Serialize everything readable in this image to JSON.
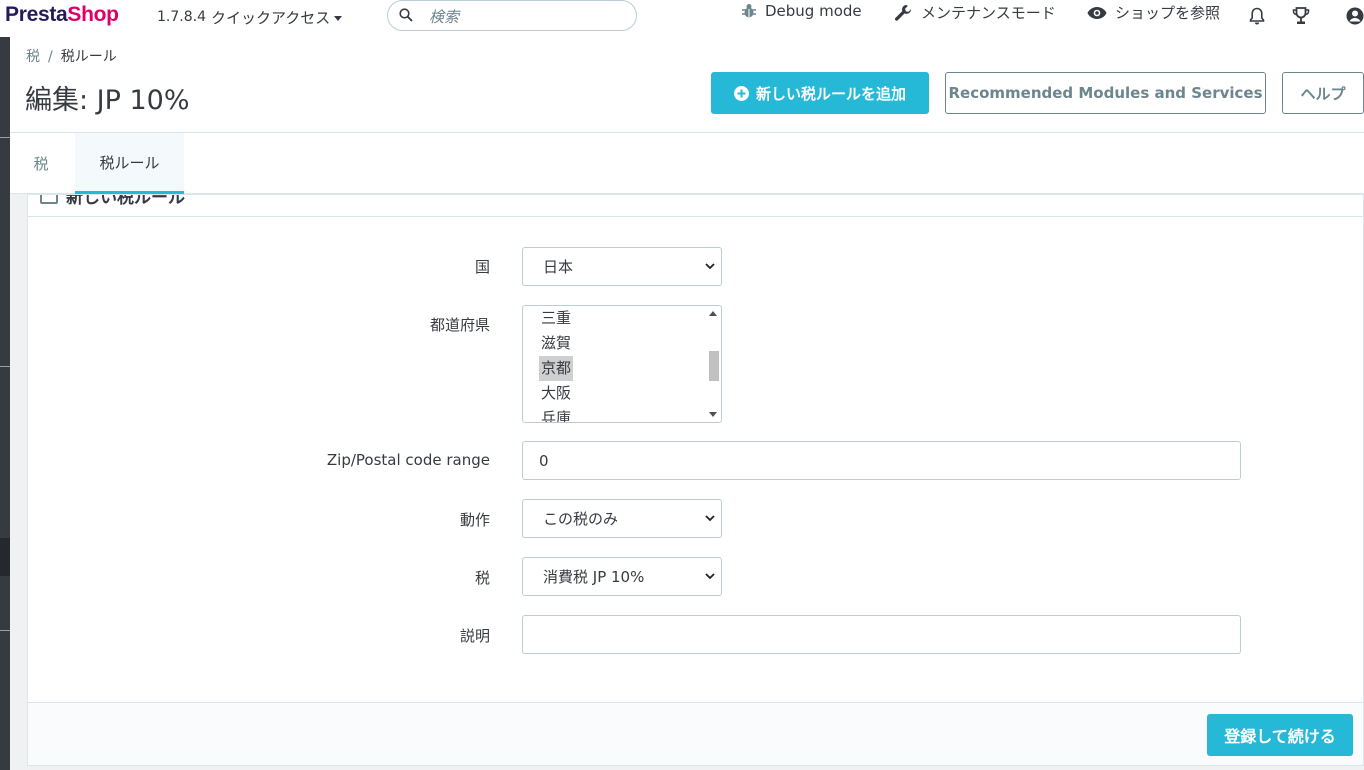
{
  "header": {
    "logo_part1": "Presta",
    "logo_part2": "Shop",
    "version": "1.7.8.4",
    "quick_access": "クイックアクセス",
    "search_placeholder": "検索",
    "debug_mode": "Debug mode",
    "maintenance": "メンテナンスモード",
    "view_shop": "ショップを参照"
  },
  "breadcrumb": {
    "parent": "税",
    "separator": "/",
    "current": "税ルール"
  },
  "page": {
    "title": "編集: JP 10%"
  },
  "toolbar": {
    "add_label": "新しい税ルールを追加",
    "recommended_label": "Recommended Modules and Services",
    "help_label": "ヘルプ"
  },
  "tabs": [
    {
      "label": "税"
    },
    {
      "label": "税ルール"
    }
  ],
  "panel": {
    "title": "新しい税ルール"
  },
  "form": {
    "country_label": "国",
    "country_value": "日本",
    "state_label": "都道府県",
    "state_options": [
      "三重",
      "滋賀",
      "京都",
      "大阪",
      "兵庫"
    ],
    "state_selected": "京都",
    "zip_label": "Zip/Postal code range",
    "zip_value": "0",
    "behavior_label": "動作",
    "behavior_value": "この税のみ",
    "tax_label": "税",
    "tax_value": "消費税 JP 10%",
    "description_label": "説明",
    "description_value": ""
  },
  "footer": {
    "save_label": "登録して続ける"
  },
  "colors": {
    "accent": "#25b9d7",
    "sidebar": "#363a41",
    "logo_dark": "#251b5b",
    "logo_pink": "#df0067"
  },
  "icons": {
    "search": "search-icon",
    "debug": "bug-icon",
    "maintenance": "wrench-icon",
    "view": "eye-icon",
    "notifications": "bell-icon",
    "trophy": "trophy-icon",
    "account": "user-icon",
    "add": "plus-circle-icon"
  }
}
